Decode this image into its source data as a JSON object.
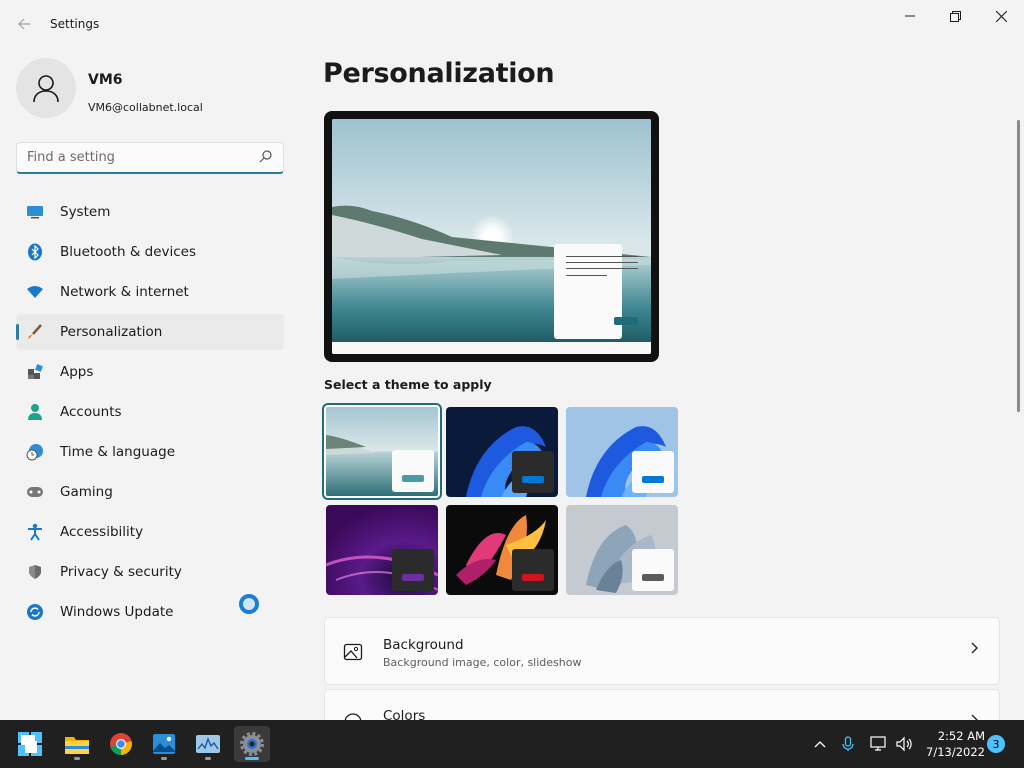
{
  "window": {
    "title": "Settings"
  },
  "profile": {
    "name": "VM6",
    "email": "VM6@collabnet.local"
  },
  "search": {
    "placeholder": "Find a setting"
  },
  "nav": {
    "items": [
      {
        "label": "System",
        "icon": "monitor-icon"
      },
      {
        "label": "Bluetooth & devices",
        "icon": "bluetooth-icon"
      },
      {
        "label": "Network & internet",
        "icon": "wifi-icon"
      },
      {
        "label": "Personalization",
        "icon": "brush-icon",
        "active": true
      },
      {
        "label": "Apps",
        "icon": "apps-icon"
      },
      {
        "label": "Accounts",
        "icon": "person-icon"
      },
      {
        "label": "Time & language",
        "icon": "clock-globe-icon"
      },
      {
        "label": "Gaming",
        "icon": "gamepad-icon"
      },
      {
        "label": "Accessibility",
        "icon": "accessibility-icon"
      },
      {
        "label": "Privacy & security",
        "icon": "shield-icon"
      },
      {
        "label": "Windows Update",
        "icon": "update-icon"
      }
    ]
  },
  "main": {
    "title": "Personalization",
    "themes_label": "Select a theme to apply",
    "themes": [
      {
        "name": "windows-light-lake",
        "selected": true,
        "accent": "#4a9aa8"
      },
      {
        "name": "windows-dark-bloom",
        "accent": "#0078d4"
      },
      {
        "name": "windows-light-bloom",
        "accent": "#0078d4"
      },
      {
        "name": "glow",
        "accent": "#6b2fa0"
      },
      {
        "name": "captured-motion",
        "accent": "#d0141f"
      },
      {
        "name": "flow",
        "accent": "#5a5a5a"
      }
    ],
    "cards": [
      {
        "title": "Background",
        "subtitle": "Background image, color, slideshow",
        "icon": "image-icon"
      },
      {
        "title": "Colors",
        "subtitle": "",
        "icon": "palette-icon"
      }
    ]
  },
  "taskbar": {
    "apps": [
      "start-icon",
      "file-explorer-icon",
      "chrome-icon",
      "photos-icon",
      "task-manager-icon",
      "settings-icon"
    ],
    "time": "2:52 AM",
    "date": "7/13/2022",
    "notifications": "3"
  },
  "colors": {
    "accent": "#2d7d9a",
    "taskbar": "#202020",
    "taskbar_active": "#4cc2ff"
  }
}
